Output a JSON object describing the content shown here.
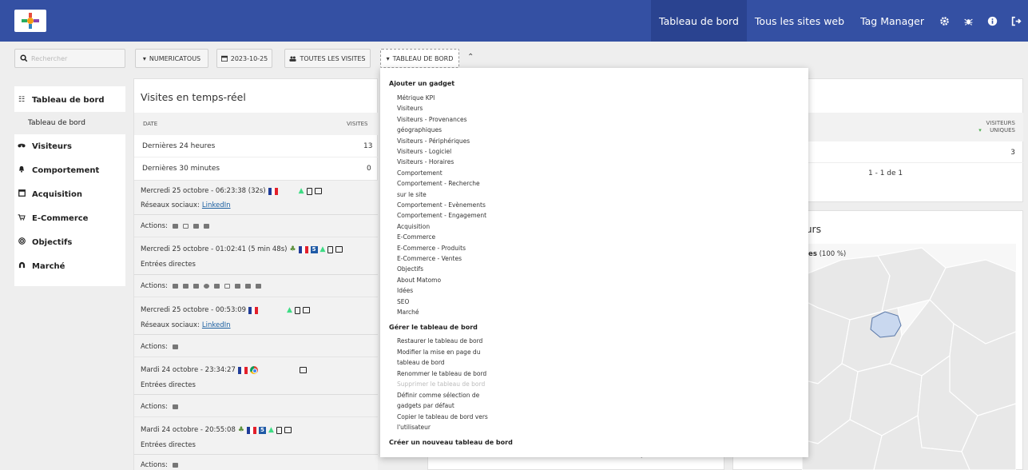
{
  "topnav": {
    "items": [
      "Tableau de bord",
      "Tous les sites web",
      "Tag Manager"
    ],
    "icons": [
      "gear-icon",
      "bug-icon",
      "info-icon",
      "logout-icon"
    ]
  },
  "toolbar": {
    "search_placeholder": "Rechercher",
    "site": "NUMERICATOUS",
    "date": "2023-10-25",
    "segment": "TOUTES LES VISITES",
    "dashboard": "TABLEAU DE BORD"
  },
  "leftmenu": {
    "items": [
      {
        "label": "Tableau de bord",
        "icon": "dashboard-icon"
      },
      {
        "label": "Tableau de bord"
      },
      {
        "label": "Visiteurs",
        "icon": "binoculars-icon"
      },
      {
        "label": "Comportement",
        "icon": "bell-icon"
      },
      {
        "label": "Acquisition",
        "icon": "window-icon"
      },
      {
        "label": "E-Commerce",
        "icon": "cart-icon"
      },
      {
        "label": "Objectifs",
        "icon": "target-icon"
      },
      {
        "label": "Marché",
        "icon": "magnet-icon"
      }
    ]
  },
  "realtime": {
    "title": "Visites en temps-réel",
    "col_date": "DATE",
    "col_visits": "VISITES",
    "rows": [
      {
        "label": "Dernières 24 heures",
        "value": "13"
      },
      {
        "label": "Dernières 30 minutes",
        "value": "0"
      }
    ],
    "actions_label": "Actions:",
    "visits": [
      {
        "time": "Mercredi 25 octobre - 06:23:38 (32s)",
        "source_label": "Réseaux sociaux:",
        "source_link": "LinkedIn"
      },
      {
        "time": "Mercredi 25 octobre - 01:02:41 (5 min 48s)",
        "source_label": "Entrées directes",
        "source_link": ""
      },
      {
        "time": "Mercredi 25 octobre - 00:53:09",
        "source_label": "Réseaux sociaux:",
        "source_link": "LinkedIn"
      },
      {
        "time": "Mardi 24 octobre - 23:34:27",
        "source_label": "Entrées directes",
        "source_link": ""
      },
      {
        "time": "Mardi 24 octobre - 20:55:08",
        "source_label": "Entrées directes",
        "source_link": ""
      }
    ]
  },
  "right_widget": {
    "col_visitors": "VISITEURS UNIQUES",
    "value": "3",
    "pagination": "1 - 1 de 1",
    "map_title_fragment": "teurs",
    "map_legend_fragment": "ues",
    "map_legend_pct": "(100 %)"
  },
  "dropdown": {
    "add_heading": "Ajouter un gadget",
    "add_items": [
      "Métrique KPI",
      "Visiteurs",
      "Visiteurs - Provenances",
      "géographiques",
      "Visiteurs - Périphériques",
      "Visiteurs - Logiciel",
      "Visiteurs - Horaires",
      "Comportement",
      "Comportement - Recherche",
      "sur le site",
      "Comportement - Evènements",
      "Comportement - Engagement",
      "Acquisition",
      "E-Commerce",
      "E-Commerce - Produits",
      "E-Commerce - Ventes",
      "Objectifs",
      "About Matomo",
      "Idées",
      "SEO",
      "Marché"
    ],
    "manage_heading": "Gérer le tableau de bord",
    "manage_items": [
      "Restaurer le tableau de bord",
      "Modifier la mise en page du",
      "tableau de bord",
      "Renommer le tableau de bord",
      "Supprimer le tableau de bord",
      "Définir comme sélection de",
      "gadgets par défaut",
      "Copier le tableau de bord vers",
      "l'utilisateur"
    ],
    "create_heading": "Créer un nouveau tableau de bord",
    "bottom_fragment": "UNIQUES"
  },
  "colors": {
    "topbar": "#3450a3",
    "topbar_active": "#2a4390",
    "link": "#1a5ea0",
    "map_region": "#e8e8e8",
    "map_highlight": "#c9d8ef"
  }
}
